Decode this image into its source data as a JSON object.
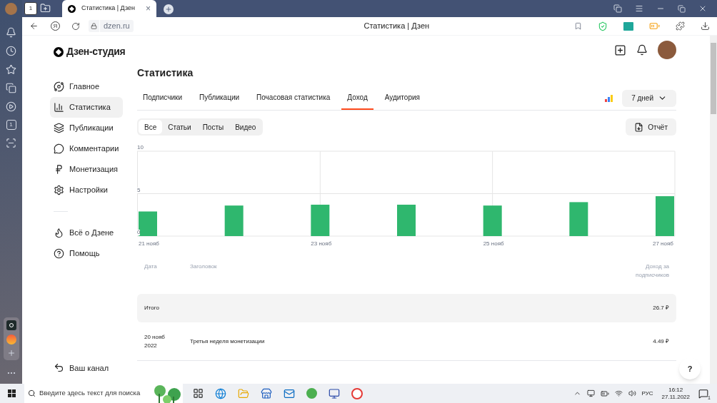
{
  "browser": {
    "home_tab_count": "1",
    "tab": {
      "title": "Статистика | Дзен",
      "close": "×"
    },
    "yandex_button": "Я",
    "address": "dzen.ru",
    "page_title": "Статистика | Дзен",
    "side_badge": "1"
  },
  "studio": {
    "logo": "Дзен-студия",
    "nav": [
      {
        "label": "Главное",
        "selected": false
      },
      {
        "label": "Статистика",
        "selected": true
      },
      {
        "label": "Публикации",
        "selected": false
      },
      {
        "label": "Комментарии",
        "selected": false
      },
      {
        "label": "Монетизация",
        "selected": false
      },
      {
        "label": "Настройки",
        "selected": false
      }
    ],
    "nav_extra": [
      {
        "label": "Всё о Дзене"
      },
      {
        "label": "Помощь"
      }
    ],
    "channel_link": "Ваш канал",
    "title": "Статистика",
    "tabs": [
      {
        "label": "Подписчики",
        "selected": false
      },
      {
        "label": "Публикации",
        "selected": false
      },
      {
        "label": "Почасовая статистика",
        "selected": false
      },
      {
        "label": "Доход",
        "selected": true
      },
      {
        "label": "Аудитория",
        "selected": false
      }
    ],
    "period": "7 дней",
    "filters": [
      {
        "label": "Все",
        "selected": true
      },
      {
        "label": "Статьи",
        "selected": false
      },
      {
        "label": "Посты",
        "selected": false
      },
      {
        "label": "Видео",
        "selected": false
      }
    ],
    "report_button": "Отчёт",
    "chart_data": {
      "type": "bar",
      "categories": [
        "21 нояб",
        null,
        "23 нояб",
        null,
        "25 нояб",
        null,
        "27 нояб"
      ],
      "series": [
        {
          "color": "#2fb76e",
          "values": [
            2.9,
            3.6,
            3.7,
            3.7,
            3.6,
            4.0,
            4.7
          ]
        }
      ],
      "ylim": [
        0,
        10
      ],
      "yticks": [
        0,
        5,
        10
      ],
      "grid": true
    },
    "table": {
      "columns": [
        "Дата",
        "Заголовок",
        "Доход за подписчиков"
      ],
      "total": {
        "label": "Итого",
        "value": "26.7 ₽"
      },
      "rows": [
        {
          "date": "20 нояб 2022",
          "title": "Третья неделя монетизации",
          "value": "4.49 ₽"
        }
      ]
    },
    "help_button": "?"
  },
  "taskbar": {
    "search_placeholder": "Введите здесь текст для поиска",
    "language": "РУС",
    "time": "16:12",
    "date": "27.11.2022",
    "notifications": "1"
  }
}
